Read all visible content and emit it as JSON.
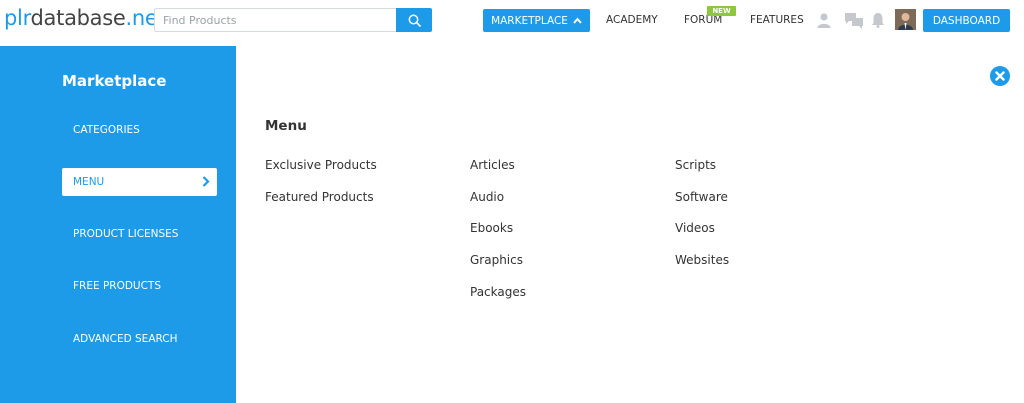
{
  "logo": {
    "part1": "plr",
    "part2": "database",
    "part3": ".net"
  },
  "search": {
    "placeholder": "Find Products"
  },
  "nav": {
    "marketplace": "MARKETPLACE",
    "academy": "ACADEMY",
    "forum": "FORUM",
    "forum_badge": "NEW",
    "features": "FEATURES",
    "dashboard": "DASHBOARD"
  },
  "icons": {
    "search": "search-icon",
    "chevron_up": "chevron-up-icon",
    "user": "user-icon",
    "messages": "chat-icon",
    "notifications": "bell-icon",
    "close": "close-icon",
    "chevron_right": "chevron-right-icon"
  },
  "colors": {
    "accent": "#1e9be8",
    "badge": "#8dc63f",
    "icon_gray": "#c5c9cd"
  },
  "sidebar": {
    "title": "Marketplace",
    "items": [
      {
        "label": "CATEGORIES",
        "active": false
      },
      {
        "label": "MENU",
        "active": true
      },
      {
        "label": "PRODUCT LICENSES",
        "active": false
      },
      {
        "label": "FREE PRODUCTS",
        "active": false
      },
      {
        "label": "ADVANCED SEARCH",
        "active": false
      }
    ]
  },
  "main": {
    "title": "Menu",
    "columns": [
      [
        "Exclusive Products",
        "Featured Products"
      ],
      [
        "Articles",
        "Audio",
        "Ebooks",
        "Graphics",
        "Packages"
      ],
      [
        "Scripts",
        "Software",
        "Videos",
        "Websites"
      ]
    ]
  }
}
